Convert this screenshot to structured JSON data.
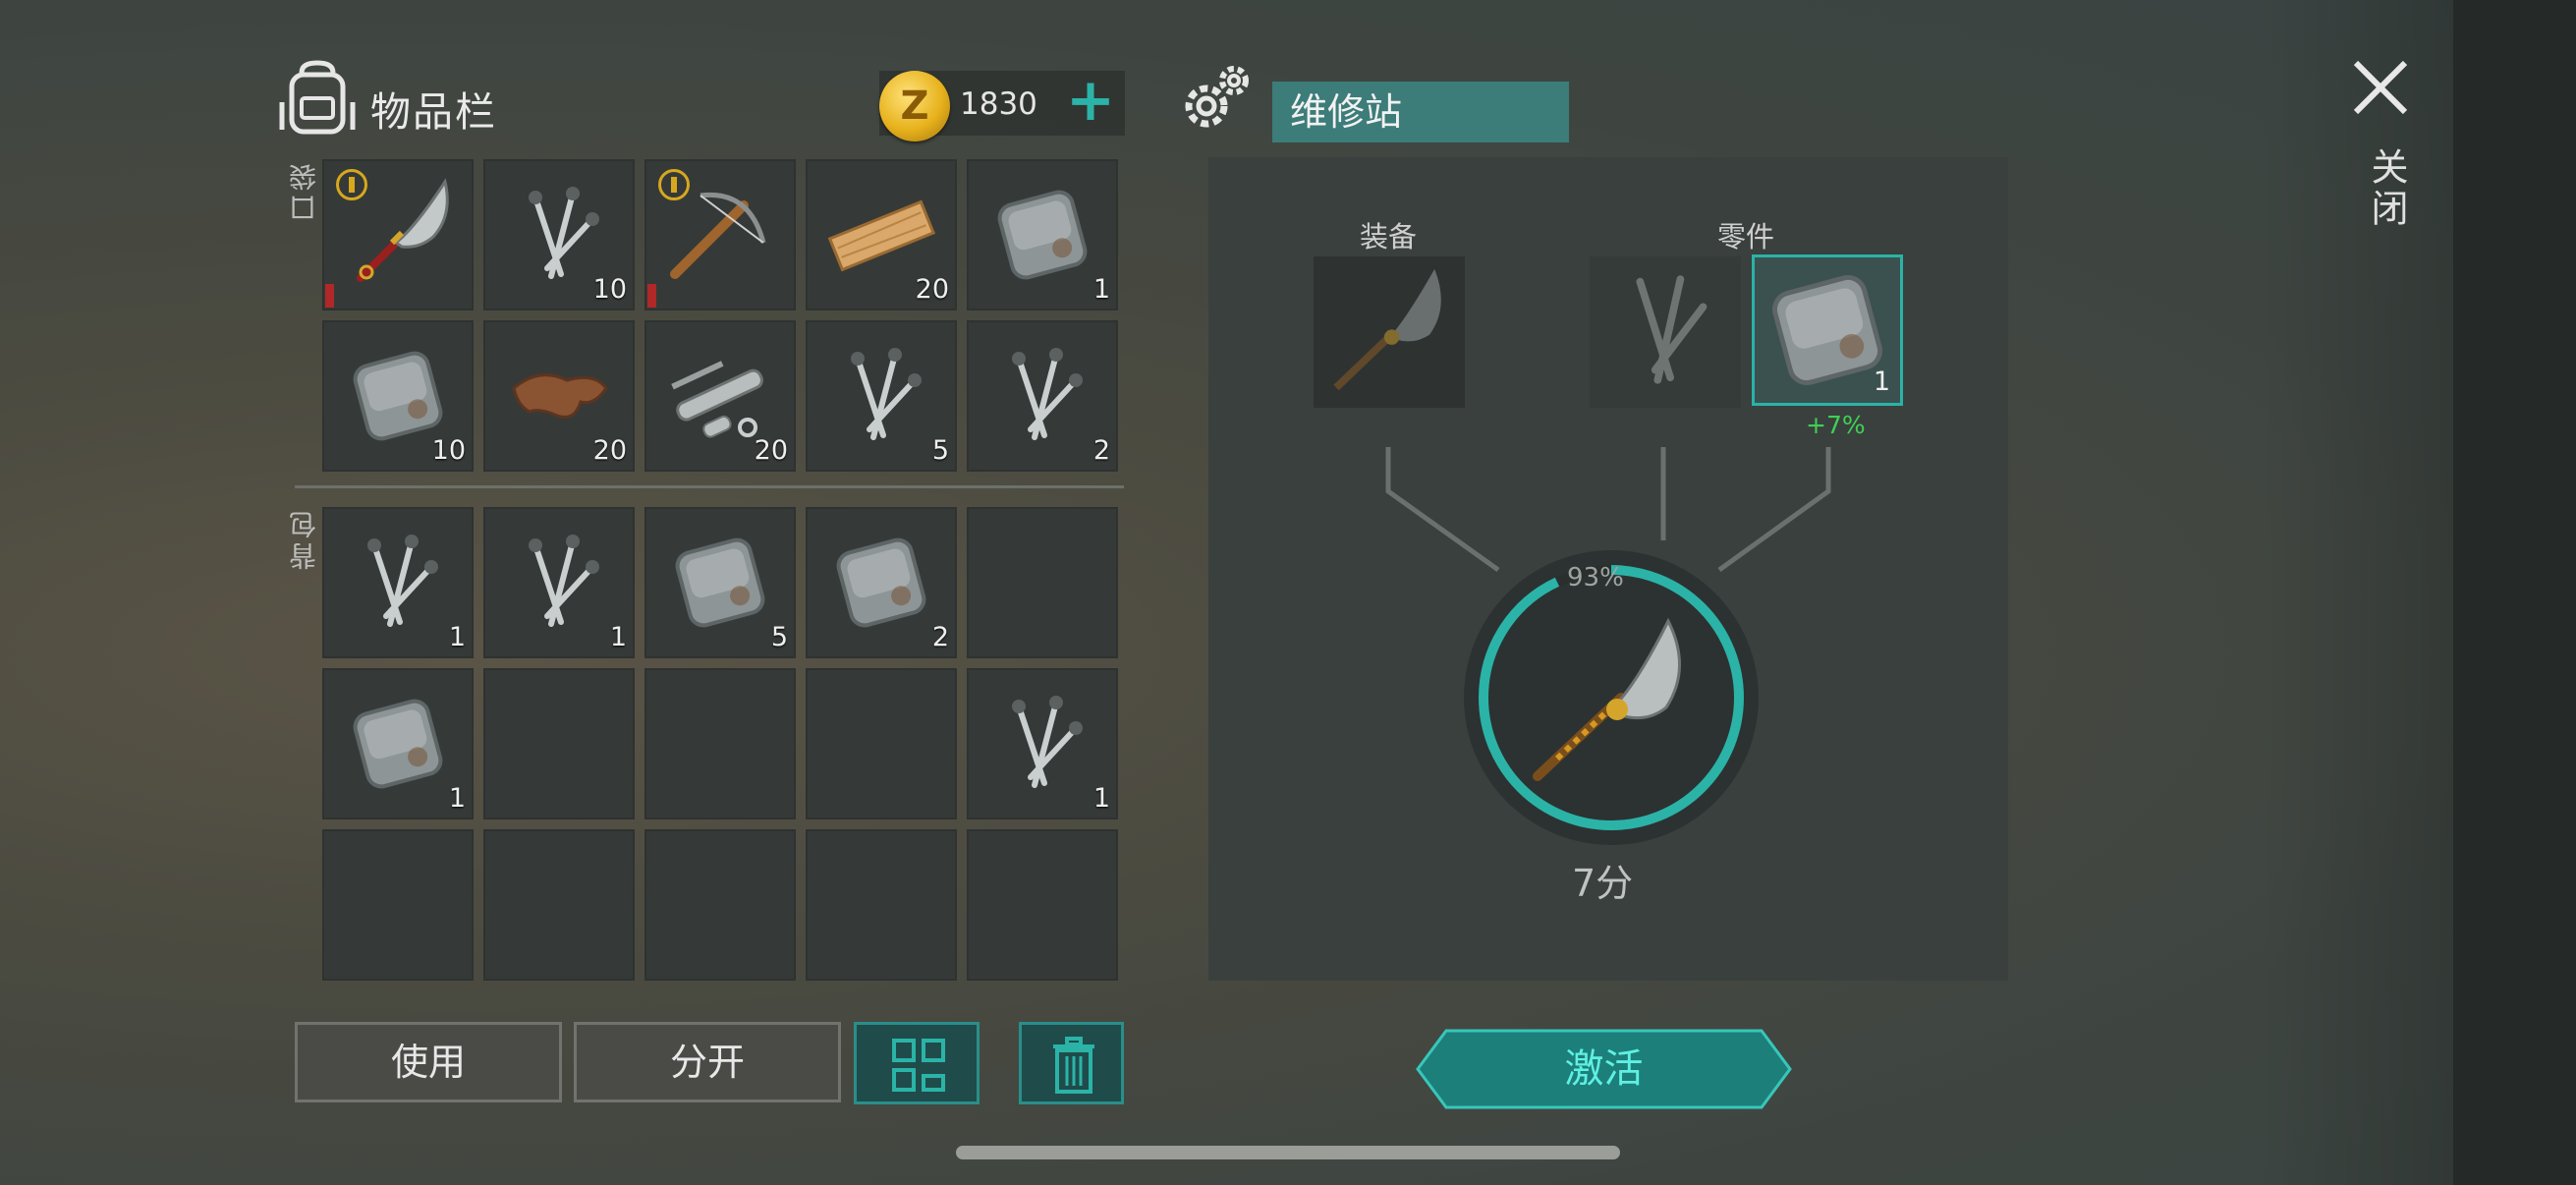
{
  "inventory": {
    "title": "物品栏",
    "coins": "1830",
    "add_coins_label": "+",
    "pocket_label": "口袋",
    "backpack_label": "背包",
    "pocket_slots": [
      {
        "item": "machete",
        "count": "",
        "worn": true,
        "badge": true
      },
      {
        "item": "nails",
        "count": "10"
      },
      {
        "item": "crossbow",
        "count": "",
        "worn": true,
        "badge": true
      },
      {
        "item": "plank",
        "count": "20"
      },
      {
        "item": "metal-plate",
        "count": "1"
      },
      {
        "item": "metal-plate",
        "count": "10"
      },
      {
        "item": "leather",
        "count": "20"
      },
      {
        "item": "pipe-parts",
        "count": "20"
      },
      {
        "item": "nails",
        "count": "5"
      },
      {
        "item": "nails",
        "count": "2"
      }
    ],
    "backpack_slots": [
      {
        "item": "nails",
        "count": "1"
      },
      {
        "item": "nails",
        "count": "1"
      },
      {
        "item": "metal-plate",
        "count": "5"
      },
      {
        "item": "metal-plate",
        "count": "2"
      },
      {
        "item": "",
        "count": ""
      },
      {
        "item": "metal-plate",
        "count": "1"
      },
      {
        "item": "",
        "count": ""
      },
      {
        "item": "",
        "count": ""
      },
      {
        "item": "",
        "count": ""
      },
      {
        "item": "nails",
        "count": "1"
      },
      {
        "item": "",
        "count": ""
      },
      {
        "item": "",
        "count": ""
      },
      {
        "item": "",
        "count": ""
      },
      {
        "item": "",
        "count": ""
      },
      {
        "item": "",
        "count": ""
      }
    ],
    "use_label": "使用",
    "split_label": "分开"
  },
  "station": {
    "name": "维修站",
    "equipment_label": "装备",
    "parts_label": "零件",
    "equipment_item": "machete",
    "part_slots": [
      {
        "item": "nails",
        "count": "",
        "ghost": true
      },
      {
        "item": "metal-plate",
        "count": "1",
        "selected": true
      }
    ],
    "bonus": "+7%",
    "progress_text": "93%",
    "progress": 0.93,
    "time": "7分",
    "activate_label": "激活"
  },
  "close_label": "关闭",
  "colors": {
    "accent": "#2bb3a8",
    "bonus": "#3fd054",
    "coin": "#e7b21c"
  }
}
